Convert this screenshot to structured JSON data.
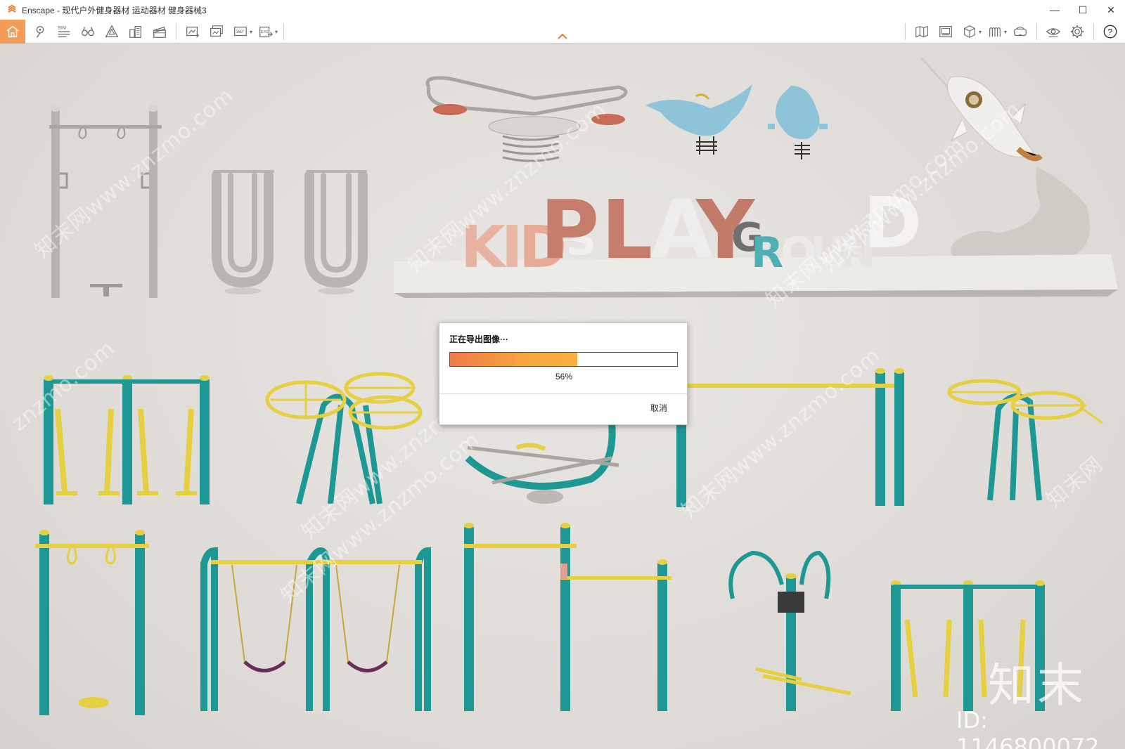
{
  "window": {
    "title": "Enscape - 现代户外健身器材 运动器材 健身器械3",
    "controls": {
      "minimize": "—",
      "maximize": "☐",
      "close": "✕"
    }
  },
  "toolbar": {
    "left_icons": [
      "home-icon",
      "map-pin-icon",
      "bim-icon",
      "binoculars-icon",
      "asset-library-icon",
      "buildings-icon",
      "clapperboard-icon"
    ],
    "export_icons": [
      "screenshot-icon",
      "batch-render-icon",
      "panorama-360-icon",
      "exe-export-icon"
    ],
    "bim_label": "BIM",
    "panorama_label": "360°",
    "exe_label": "EXE",
    "right_icons": [
      "map-icon",
      "video-editor-icon",
      "cube-view-icon",
      "material-icon",
      "vr-headset-icon",
      "eye-visual-settings-icon",
      "gear-icon",
      "help-icon"
    ],
    "help_label": "?"
  },
  "viewport": {
    "watermarks": [
      "知末网www.znzmo.com",
      "知末网www.znzmo.com",
      "知末网www.znzmo.com",
      "知末网www.znzmo.com",
      "znzmo.com",
      "知末网www.znzmo.com",
      "知末网www.znzmo.com",
      "知末网",
      "知末网www.znzmo.com"
    ],
    "brand_mark": "知末",
    "id_mark": "ID: 1146800072",
    "sign_letters": [
      "K",
      "I",
      "D",
      "S",
      "P",
      "L",
      "A",
      "Y",
      "G",
      "R",
      "O",
      "U",
      "N",
      "D"
    ]
  },
  "export_dialog": {
    "title": "正在导出图像···",
    "progress": 0.56,
    "progress_text": "56%",
    "cancel_label": "取消"
  },
  "colors": {
    "accent": "#f39c58",
    "teal": "#1e9894",
    "yellow": "#e6cf40",
    "silver": "#b9b6b1"
  }
}
